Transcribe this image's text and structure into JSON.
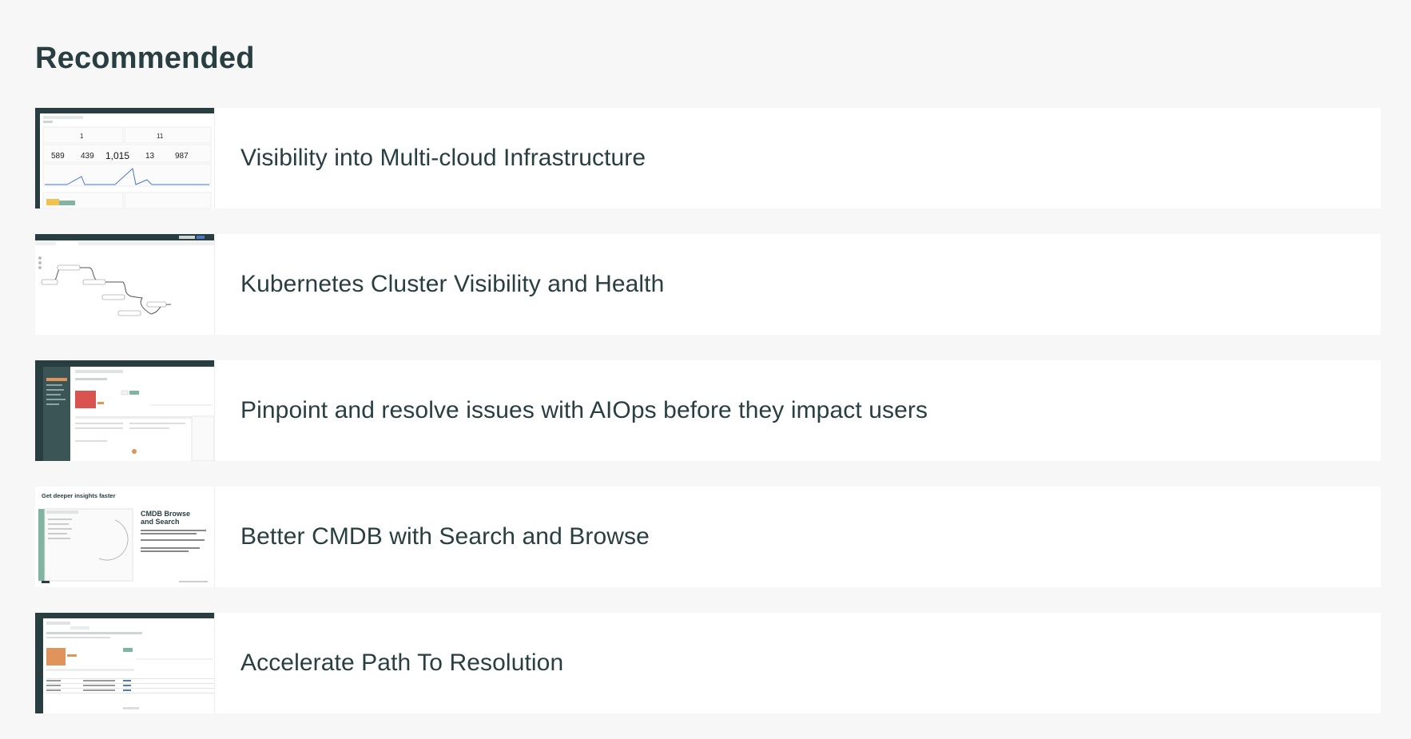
{
  "section": {
    "heading": "Recommended",
    "items": [
      {
        "title": "Visibility into Multi-cloud Infrastructure",
        "thumb_kind": "dashboard",
        "thumb_numbers_top": [
          "1",
          "11"
        ],
        "thumb_numbers_row": [
          "589",
          "439",
          "1,015",
          "13",
          "987"
        ]
      },
      {
        "title": "Kubernetes Cluster Visibility and Health",
        "thumb_kind": "topology"
      },
      {
        "title": "Pinpoint and resolve issues with AIOps before they impact users",
        "thumb_kind": "aiops"
      },
      {
        "title": "Better CMDB with Search and Browse",
        "thumb_kind": "cmdb",
        "thumb_heading": "Get deeper insights faster",
        "thumb_subheading_line1": "CMDB Browse",
        "thumb_subheading_line2": "and Search"
      },
      {
        "title": "Accelerate Path To Resolution",
        "thumb_kind": "resolution"
      }
    ]
  },
  "colors": {
    "page_bg": "#f7f7f7",
    "card_bg": "#ffffff",
    "text": "#293e40",
    "app_header": "#293e40",
    "accent_green": "#81b5a1",
    "alert_red": "#d9534f",
    "alert_orange": "#e0935a",
    "chart_blue": "#4a78c9"
  }
}
